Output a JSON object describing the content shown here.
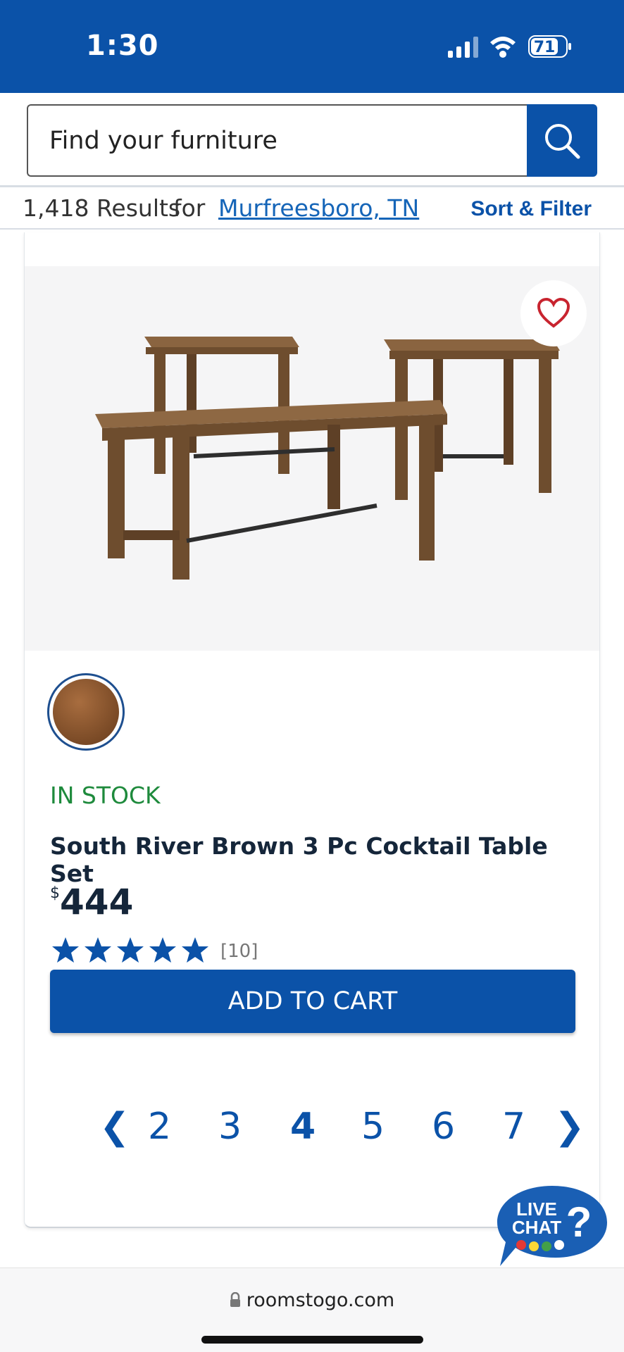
{
  "status": {
    "time": "1:30",
    "battery": "71"
  },
  "search": {
    "placeholder": "Find your furniture"
  },
  "results": {
    "count": "1,418 Results",
    "for": "for",
    "location": "Murfreesboro, TN",
    "sort_filter": "Sort & Filter"
  },
  "product": {
    "stock": "IN STOCK",
    "title": "South River Brown 3 Pc Cocktail Table Set",
    "currency": "$",
    "price": "444",
    "rating": 5,
    "review_count": "[10]",
    "add_to_cart": "ADD TO CART",
    "swatch_color": "#8a5630"
  },
  "pagination": {
    "prev": "❮",
    "pages": [
      "2",
      "3",
      "4",
      "5",
      "6",
      "7"
    ],
    "current": "4",
    "next": "❯"
  },
  "livechat": {
    "line1": "LIVE",
    "line2": "CHAT"
  },
  "browser": {
    "url": "roomstogo.com"
  },
  "colors": {
    "brand_blue": "#0b52a8",
    "stock_green": "#1e8a3c",
    "heart_red": "#c8242f"
  }
}
